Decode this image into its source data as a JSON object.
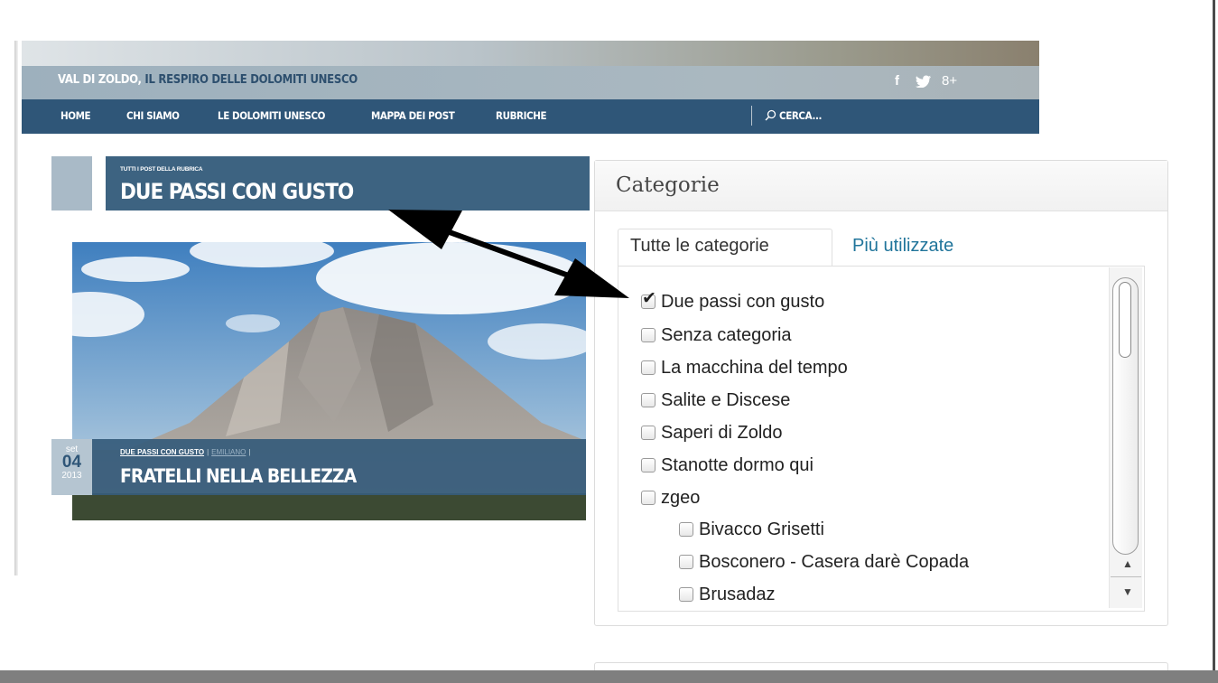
{
  "site": {
    "title_strong": "VAL DI ZOLDO,",
    "title_rest": " IL RESPIRO DELLE DOLOMITI UNESCO",
    "social": [
      "f",
      "t",
      "8+"
    ],
    "nav": [
      "HOME",
      "CHI SIAMO",
      "LE DOLOMITI UNESCO",
      "MAPPA DEI POST",
      "RUBRICHE"
    ],
    "search_label": "CERCA..."
  },
  "rubric": {
    "kicker": "TUTTI I POST DELLA RUBRICA",
    "title": "DUE PASSI CON GUSTO"
  },
  "post": {
    "date_month": "set",
    "date_day": "04",
    "date_year": "2013",
    "category": "DUE PASSI CON GUSTO",
    "author": "EMILIANO",
    "title": "FRATELLI NELLA BELLEZZA"
  },
  "categories_panel": {
    "title": "Categorie",
    "tab_all": "Tutte le categorie",
    "tab_popular": "Più utilizzate",
    "items": [
      {
        "label": "Due passi con gusto",
        "checked": true
      },
      {
        "label": "Senza categoria",
        "checked": false
      },
      {
        "label": "La macchina del tempo",
        "checked": false
      },
      {
        "label": "Salite e Discese",
        "checked": false
      },
      {
        "label": "Saperi di Zoldo",
        "checked": false
      },
      {
        "label": "Stanotte dormo qui",
        "checked": false
      },
      {
        "label": "zgeo",
        "checked": false
      },
      {
        "label": "Bivacco Grisetti",
        "checked": false
      },
      {
        "label": "Bosconero - Casera darè Copada",
        "checked": false
      },
      {
        "label": "Brusadaz",
        "checked": false
      }
    ]
  },
  "colors": {
    "nav_bg": "#2f5678",
    "rubric_bg": "#3d6381",
    "link": "#21759b"
  }
}
